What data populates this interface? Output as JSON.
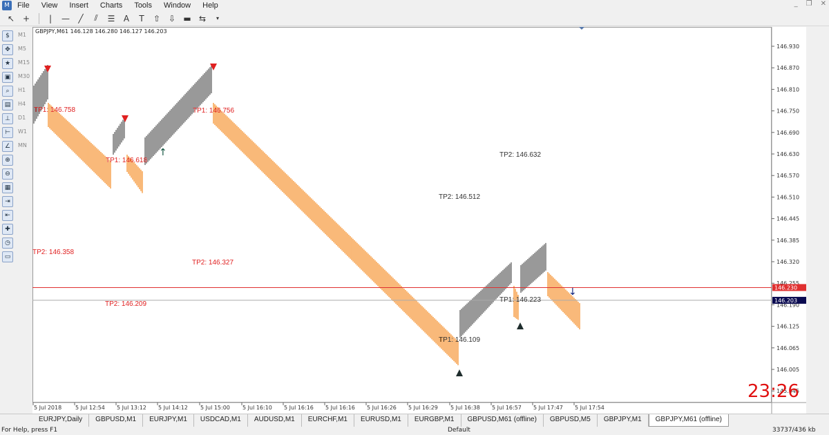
{
  "menu": [
    "File",
    "View",
    "Insert",
    "Charts",
    "Tools",
    "Window",
    "Help"
  ],
  "toolbar_icons": [
    "cursor-icon",
    "crosshair-icon",
    "vertical-line-icon",
    "horizontal-line-icon",
    "trendline-icon",
    "channel-icon",
    "fibonacci-icon",
    "text-icon",
    "text-label-icon",
    "arrow-up-icon",
    "arrow-down-icon",
    "rectangle-icon",
    "shapes-icon"
  ],
  "left_tools": [
    "market-watch-icon",
    "navigator-icon",
    "favorites-icon",
    "data-window-icon",
    "strategy-tester-icon",
    "terminal-icon",
    "trade-icon",
    "period-sep-icon",
    "indicator-icon",
    "zoom-in-icon",
    "zoom-out-icon",
    "tile-icon",
    "autoscroll-icon",
    "chart-shift-icon",
    "new-order-icon",
    "history-icon",
    "options-icon"
  ],
  "timeframes": [
    "M1",
    "M5",
    "M15",
    "M30",
    "H1",
    "H4",
    "D1",
    "W1",
    "MN"
  ],
  "chart": {
    "header": "GBPJPY,M61  146.128 146.280 146.127 146.203",
    "clock": "23:26",
    "price_labels": [
      "146.930",
      "146.870",
      "146.810",
      "146.750",
      "146.690",
      "146.630",
      "146.570",
      "146.510",
      "146.445",
      "146.385",
      "146.320",
      "146.255",
      "146.190",
      "146.125",
      "146.065",
      "146.005",
      "145.945"
    ],
    "price_tags": {
      "ask": "146.230",
      "bid": "146.203"
    },
    "time_labels": [
      "5 Jul 2018",
      "5 Jul 12:54",
      "5 Jul 13:12",
      "5 Jul 14:12",
      "5 Jul 15:00",
      "5 Jul 16:10",
      "5 Jul 16:16",
      "5 Jul 16:16",
      "5 Jul 16:26",
      "5 Jul 16:29",
      "5 Jul 16:38",
      "5 Jul 16:57",
      "5 Jul 17:47",
      "5 Jul 17:54"
    ],
    "annotations": [
      {
        "text": "TP1: 146.758",
        "color": "#e02020"
      },
      {
        "text": "TP1: 146.618",
        "color": "#e02020"
      },
      {
        "text": "TP1: 146.756",
        "color": "#e02020"
      },
      {
        "text": "TP2: 146.358",
        "color": "#e02020"
      },
      {
        "text": "TP2: 146.327",
        "color": "#e02020"
      },
      {
        "text": "TP2: 146.209",
        "color": "#e02020"
      },
      {
        "text": "TP2: 146.632",
        "color": "#333333"
      },
      {
        "text": "TP2: 146.512",
        "color": "#333333"
      },
      {
        "text": "TP1: 146.223",
        "color": "#333333"
      },
      {
        "text": "TP1: 146.109",
        "color": "#333333"
      }
    ],
    "colors": {
      "bear": "#f58a20",
      "bull": "#555555",
      "ask_line": "#e03030",
      "bid_line": "#aaaaaa",
      "clock": "#e01010"
    }
  },
  "tabs": [
    "EURJPY,Daily",
    "GBPUSD,M1",
    "EURJPY,M1",
    "USDCAD,M1",
    "AUDUSD,M1",
    "EURCHF,M1",
    "EURUSD,M1",
    "EURGBP,M1",
    "GBPUSD,M61 (offline)",
    "GBPUSD,M5",
    "GBPJPY,M1",
    "GBPJPY,M61 (offline)"
  ],
  "active_tab": "GBPJPY,M61 (offline)",
  "status": {
    "help": "For Help, press F1",
    "profile": "Default",
    "traffic": "33737/436 kb"
  }
}
